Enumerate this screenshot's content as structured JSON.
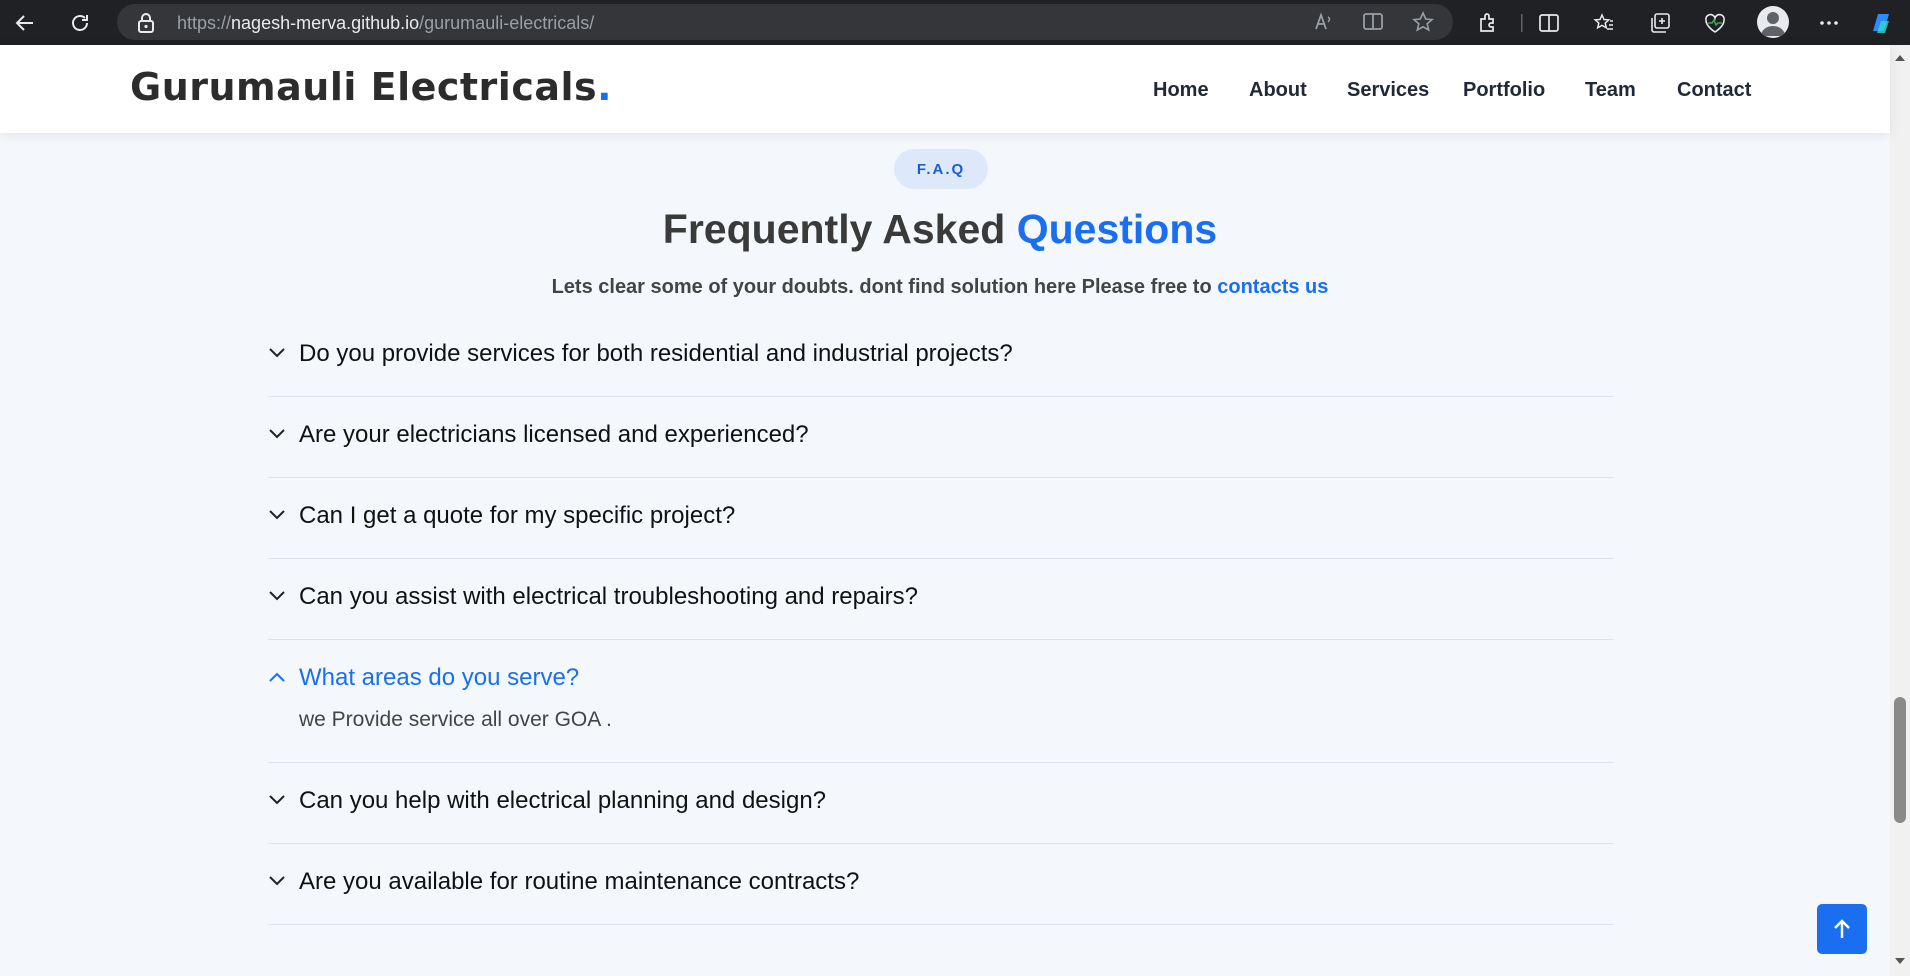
{
  "browser": {
    "url_prefix": "https://",
    "url_host": "nagesh-merva.github.io",
    "url_path": "/gurumauli-electricals/"
  },
  "header": {
    "logo_text": "Gurumauli Electricals",
    "logo_dot": ".",
    "nav": [
      "Home",
      "About",
      "Services",
      "Portfolio",
      "Team",
      "Contact"
    ]
  },
  "faq": {
    "badge": "F.A.Q",
    "title_main": "Frequently Asked ",
    "title_accent": "Questions",
    "subtitle_main": "Lets clear some of your doubts. dont find solution here Please free to ",
    "subtitle_link": "contacts us",
    "items": [
      {
        "question": "Do you provide services for both residential and industrial projects?",
        "open": false
      },
      {
        "question": "Are your electricians licensed and experienced?",
        "open": false
      },
      {
        "question": "Can I get a quote for my specific project?",
        "open": false
      },
      {
        "question": "Can you assist with electrical troubleshooting and repairs?",
        "open": false
      },
      {
        "question": "What areas do you serve?",
        "open": true,
        "answer": "we Provide service all over GOA ."
      },
      {
        "question": "Can you help with electrical planning and design?",
        "open": false
      },
      {
        "question": "Are you available for routine maintenance contracts?",
        "open": false
      }
    ]
  },
  "colors": {
    "accent": "#1a6ff0",
    "page_bg": "#f4f8fd",
    "badge_bg": "#dde9fa"
  }
}
